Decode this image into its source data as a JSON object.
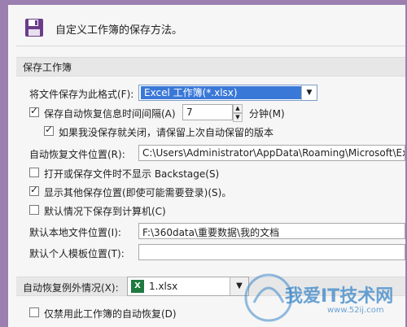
{
  "header": {
    "text": "自定义工作簿的保存方法。"
  },
  "section_save": {
    "title": "保存工作簿"
  },
  "format": {
    "label": "将文件保存为此格式(F):",
    "value": "Excel 工作簿(*.xlsx)"
  },
  "autorecover": {
    "label": "保存自动恢复信息时间间隔(A)",
    "value": "7",
    "unit": "分钟(M)",
    "checked": true
  },
  "keep_last": {
    "label": "如果我没保存就关闭，请保留上次自动保留的版本",
    "checked": true
  },
  "autorecover_location": {
    "label": "自动恢复文件位置(R):",
    "value": "C:\\Users\\Administrator\\AppData\\Roaming\\Microsoft\\Exc"
  },
  "no_backstage": {
    "label": "打开或保存文件时不显示 Backstage(S)",
    "checked": false
  },
  "show_other": {
    "label": "显示其他保存位置(即使可能需要登录)(S)。",
    "checked": true
  },
  "default_computer": {
    "label": "默认情况下保存到计算机(C)",
    "checked": false
  },
  "default_local": {
    "label": "默认本地文件位置(I):",
    "value": "F:\\360data\\重要数据\\我的文档"
  },
  "default_template": {
    "label": "默认个人模板位置(T):",
    "value": ""
  },
  "exception": {
    "label": "自动恢复例外情况(X):",
    "file": "1.xlsx"
  },
  "disable_autorecover": {
    "label": "仅禁用此工作簿的自动恢复(D)",
    "checked": false
  },
  "watermark": {
    "text": "我爱IT技术网",
    "url": "www.52ij.com"
  },
  "colors": {
    "accent": "#3a78d8",
    "frame": "#9a7fb0",
    "excel": "#1f7a3f"
  }
}
